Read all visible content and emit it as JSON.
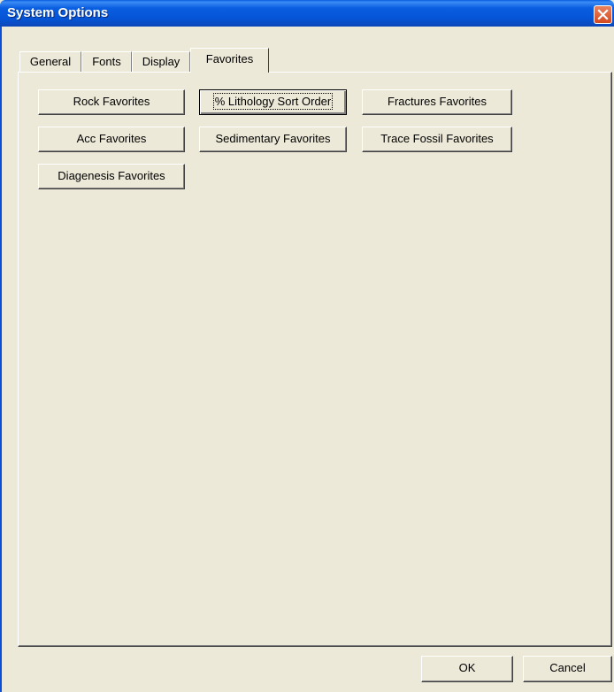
{
  "window": {
    "title": "System Options",
    "close_icon": "close-icon"
  },
  "tabs": [
    {
      "label": "General",
      "active": false
    },
    {
      "label": "Fonts",
      "active": false
    },
    {
      "label": "Display",
      "active": false
    },
    {
      "label": "Favorites",
      "active": true
    }
  ],
  "favorites": {
    "buttons": [
      {
        "label": "Rock Favorites"
      },
      {
        "label": "% Lithology Sort Order",
        "focused": true
      },
      {
        "label": "Fractures Favorites"
      },
      {
        "label": "Acc Favorites"
      },
      {
        "label": "Sedimentary Favorites"
      },
      {
        "label": "Trace Fossil Favorites"
      },
      {
        "label": "Diagenesis Favorites"
      }
    ]
  },
  "footer": {
    "ok_label": "OK",
    "cancel_label": "Cancel"
  },
  "colors": {
    "titlebar": "#0a5ee0",
    "face": "#ece9d8",
    "close": "#d6481f"
  }
}
